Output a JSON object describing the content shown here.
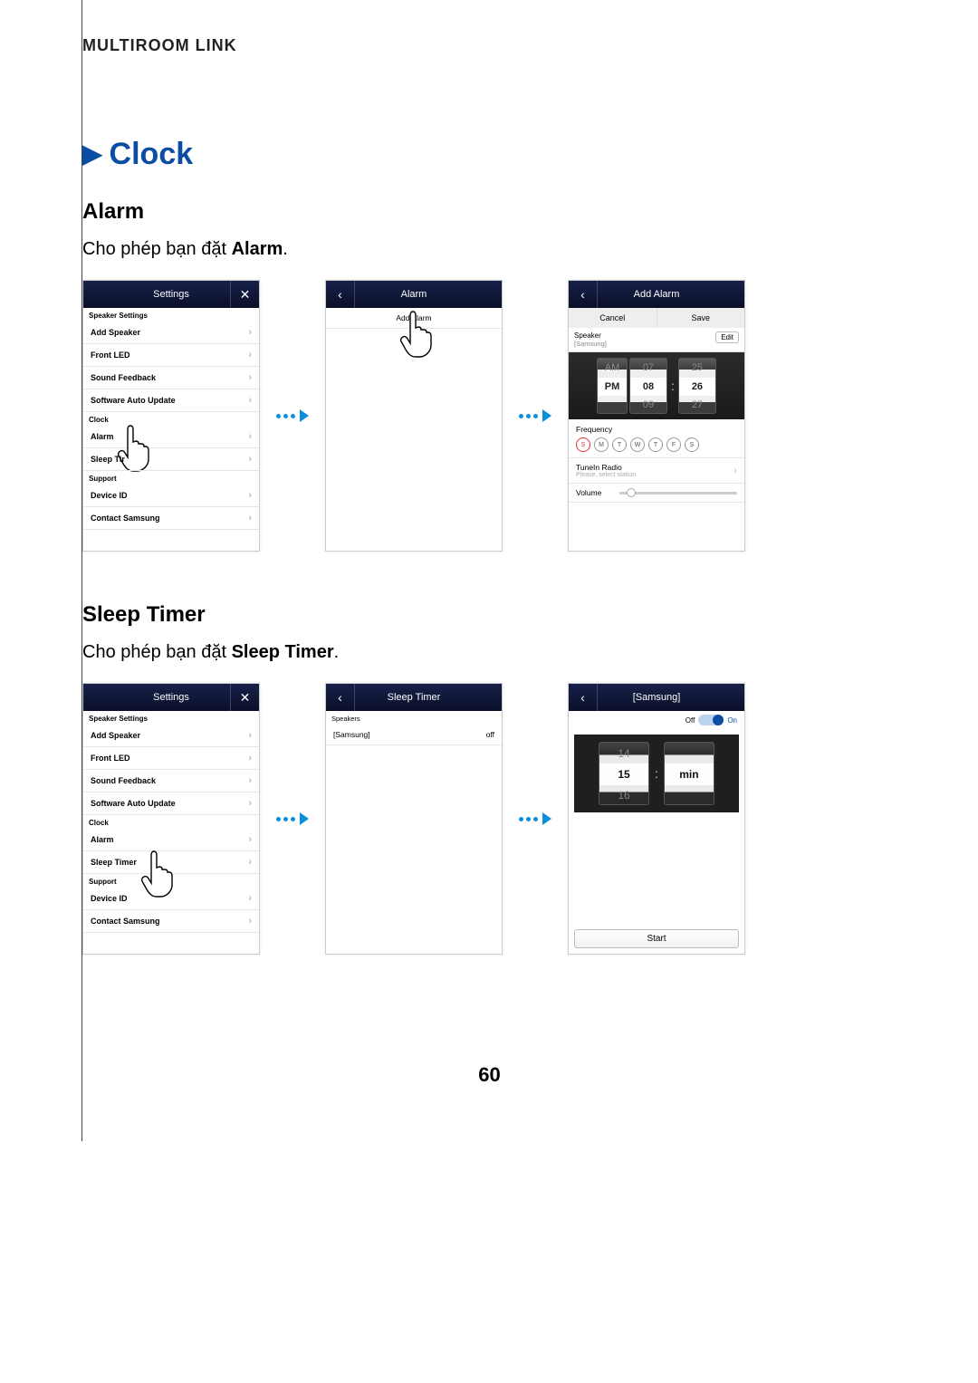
{
  "breadcrumb": "MULTIROOM LINK",
  "section_title": "Clock",
  "alarm": {
    "heading": "Alarm",
    "desc_prefix": "Cho phép bạn đặt ",
    "desc_bold": "Alarm",
    "desc_suffix": "."
  },
  "sleep": {
    "heading": "Sleep Timer",
    "desc_prefix": "Cho phép bạn đặt ",
    "desc_bold": "Sleep Timer",
    "desc_suffix": "."
  },
  "settings_panel": {
    "title": "Settings",
    "groups": {
      "speaker": "Speaker Settings",
      "clock": "Clock",
      "support": "Support"
    },
    "items": {
      "add_speaker": "Add Speaker",
      "front_led": "Front LED",
      "sound_feedback": "Sound Feedback",
      "software_auto_update": "Software Auto Update",
      "alarm": "Alarm",
      "sleep_timer_trunc": "Sleep Tir",
      "sleep_timer": "Sleep Timer",
      "device_id": "Device ID",
      "contact_samsung": "Contact Samsung"
    }
  },
  "alarm_panel": {
    "title": "Alarm",
    "add_alarm": "Add Alarm"
  },
  "add_alarm_panel": {
    "title": "Add Alarm",
    "cancel": "Cancel",
    "save": "Save",
    "speaker_label": "Speaker",
    "speaker_value": "[Samsung]",
    "edit": "Edit",
    "ampm": {
      "top": "AM",
      "mid": "PM",
      "bot": ""
    },
    "hour": {
      "top": "07",
      "mid": "08",
      "bot": "09"
    },
    "minute": {
      "top": "25",
      "mid": "26",
      "bot": "27"
    },
    "freq_label": "Frequency",
    "days": [
      "S",
      "M",
      "T",
      "W",
      "T",
      "F",
      "S"
    ],
    "tunein_label": "TuneIn Radio",
    "tunein_sub": "Please, select station",
    "volume_label": "Volume"
  },
  "sleep_timer_panel": {
    "title": "Sleep Timer",
    "speakers_label": "Speakers",
    "row_name": "[Samsung]",
    "row_status": "off"
  },
  "samsung_panel": {
    "title": "[Samsung]",
    "off": "Off",
    "on": "On",
    "min": {
      "top": "14",
      "mid": "15",
      "bot": "16"
    },
    "unit": "min",
    "start": "Start"
  },
  "page_number": "60"
}
